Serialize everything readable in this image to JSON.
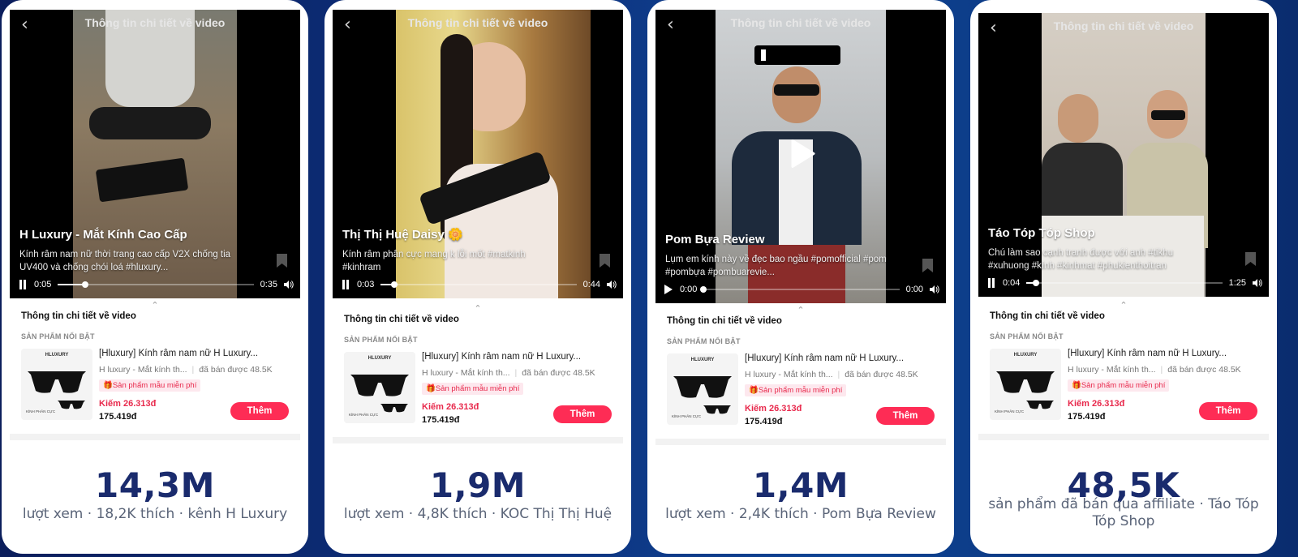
{
  "cards": [
    {
      "video": {
        "header": "Thông tin chi tiết về video",
        "creator": "H Luxury - Mắt Kính Cao Cấp",
        "caption": "Kính râm nam nữ thời trang cao cấp V2X chống tia UV400 và chống chói loá #hluxury...",
        "time_current": "0:05",
        "time_total": "0:35",
        "progress": 0.14,
        "state": "playing"
      },
      "info": {
        "title": "Thông tin chi tiết về video",
        "featured_label": "SẢN PHẨM NỔI BẬT",
        "product_title": "[Hluxury] Kính râm nam nữ H Luxury...",
        "shop": "H luxury - Mắt kính th...",
        "sold": "đã bán được 48.5K",
        "sample_badge": "Sản phẩm mẫu miễn phí",
        "earn": "Kiếm 26.313đ",
        "price": "175.419đ",
        "add_button": "Thêm",
        "image_brand": "HLUXURY",
        "image_foot": "KÍNH PHÂN CỰC"
      },
      "stat": {
        "value": "14,3M",
        "desc": "lượt xem · 18,2K thích · kênh H Luxury"
      }
    },
    {
      "video": {
        "header": "Thông tin chi tiết về video",
        "creator": "Thị Thị Huệ Daisy 🌼",
        "caption": "Kính râm phân cực mang k lỗi mốt #matkinh #kinhram",
        "time_current": "0:03",
        "time_total": "0:44",
        "progress": 0.07,
        "state": "playing"
      },
      "info": {
        "title": "Thông tin chi tiết về video",
        "featured_label": "SẢN PHẨM NỔI BẬT",
        "product_title": "[Hluxury] Kính râm nam nữ H Luxury...",
        "shop": "H luxury - Mắt kính th...",
        "sold": "đã bán được 48.5K",
        "sample_badge": "Sản phẩm mẫu miễn phí",
        "earn": "Kiếm 26.313đ",
        "price": "175.419đ",
        "add_button": "Thêm",
        "image_brand": "HLUXURY",
        "image_foot": "KÍNH PHÂN CỰC"
      },
      "stat": {
        "value": "1,9M",
        "desc": "lượt xem · 4,8K thích · KOC Thị Thị Huệ"
      }
    },
    {
      "video": {
        "header": "Thông tin chi tiết về video",
        "creator": "Pom Bựa Review",
        "caption": "Lụm em kính này về đẹc bao ngầu #pomofficial #pom #pombựa #pombuarevie...",
        "time_current": "0:00",
        "time_total": "0:00",
        "progress": 0.0,
        "state": "paused"
      },
      "info": {
        "title": "Thông tin chi tiết về video",
        "featured_label": "SẢN PHẨM NỔI BẬT",
        "product_title": "[Hluxury] Kính râm nam nữ H Luxury...",
        "shop": "H luxury - Mắt kính th...",
        "sold": "đã bán được 48.5K",
        "sample_badge": "Sản phẩm mẫu miễn phí",
        "earn": "Kiếm 26.313đ",
        "price": "175.419đ",
        "add_button": "Thêm",
        "image_brand": "HLUXURY",
        "image_foot": "KÍNH PHÂN CỰC"
      },
      "stat": {
        "value": "1,4M",
        "desc": "lượt xem · 2,4K thích · Pom Bựa Review"
      }
    },
    {
      "video": {
        "header": "Thông tin chi tiết về video",
        "creator": "Táo Tóp Tóp Shop",
        "caption": "Chú làm sao cạnh tranh được với anh #tikhu #xuhuong #kính #kinhmat #phukienthoitran",
        "time_current": "0:04",
        "time_total": "1:25",
        "progress": 0.05,
        "state": "playing"
      },
      "info": {
        "title": "Thông tin chi tiết về video",
        "featured_label": "SẢN PHẨM NỔI BẬT",
        "product_title": "[Hluxury] Kính râm nam nữ H Luxury...",
        "shop": "H luxury - Mắt kính th...",
        "sold": "đã bán được 48.5K",
        "sample_badge": "Sản phẩm mẫu miễn phí",
        "earn": "Kiếm 26.313đ",
        "price": "175.419đ",
        "add_button": "Thêm",
        "image_brand": "HLUXURY",
        "image_foot": "KÍNH PHÂN CỰC"
      },
      "stat": {
        "value": "48,5K",
        "desc": "sản phẩm đã bán qua affiliate · Táo Tóp Tóp Shop"
      }
    }
  ],
  "colors": {
    "accent": "#fe2c55",
    "stat_text": "#1a2b6d",
    "earn_text": "#e8294c",
    "background_dark": "#0b1e5c",
    "background_mid": "#0e4494"
  },
  "icons": [
    "back-icon",
    "bookmark-icon",
    "pause-icon",
    "play-icon",
    "volume-icon",
    "chevron-up-icon",
    "gift-icon",
    "sunglasses-image"
  ]
}
